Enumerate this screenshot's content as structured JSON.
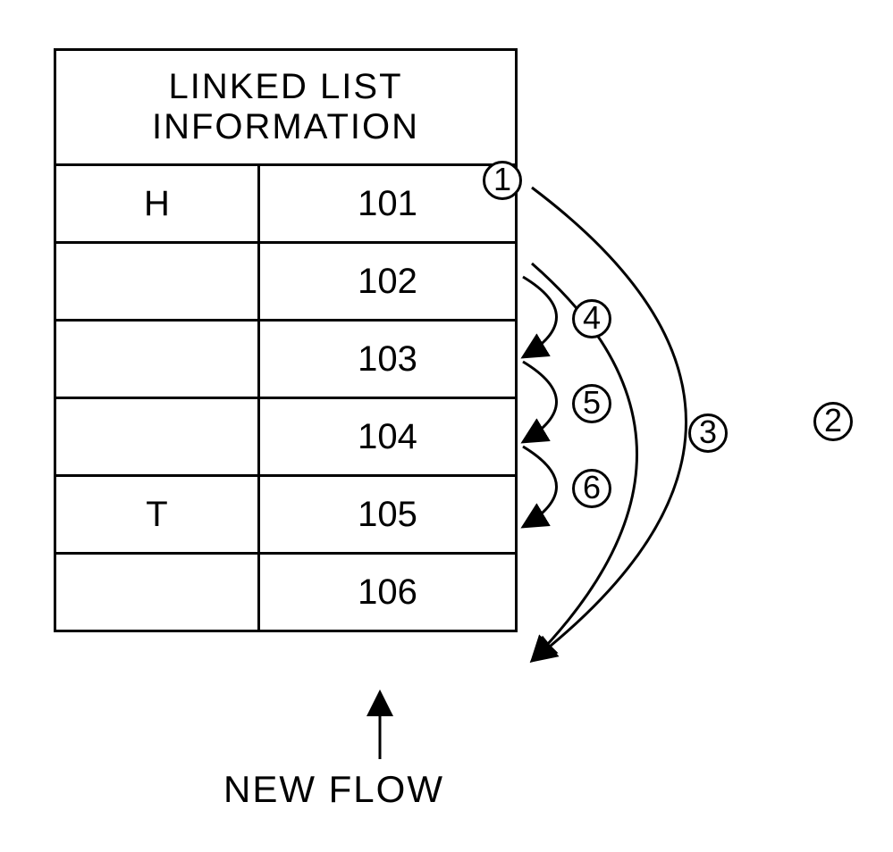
{
  "header": "LINKED LIST INFORMATION",
  "rows": [
    {
      "a": "H",
      "b": "101"
    },
    {
      "a": "",
      "b": "102"
    },
    {
      "a": "",
      "b": "103"
    },
    {
      "a": "",
      "b": "104"
    },
    {
      "a": "T",
      "b": "105"
    },
    {
      "a": "",
      "b": "106"
    }
  ],
  "markers": {
    "m1": "1",
    "m2": "2",
    "m3": "3",
    "m4": "4",
    "m5": "5",
    "m6": "6"
  },
  "newflow": "NEW FLOW"
}
